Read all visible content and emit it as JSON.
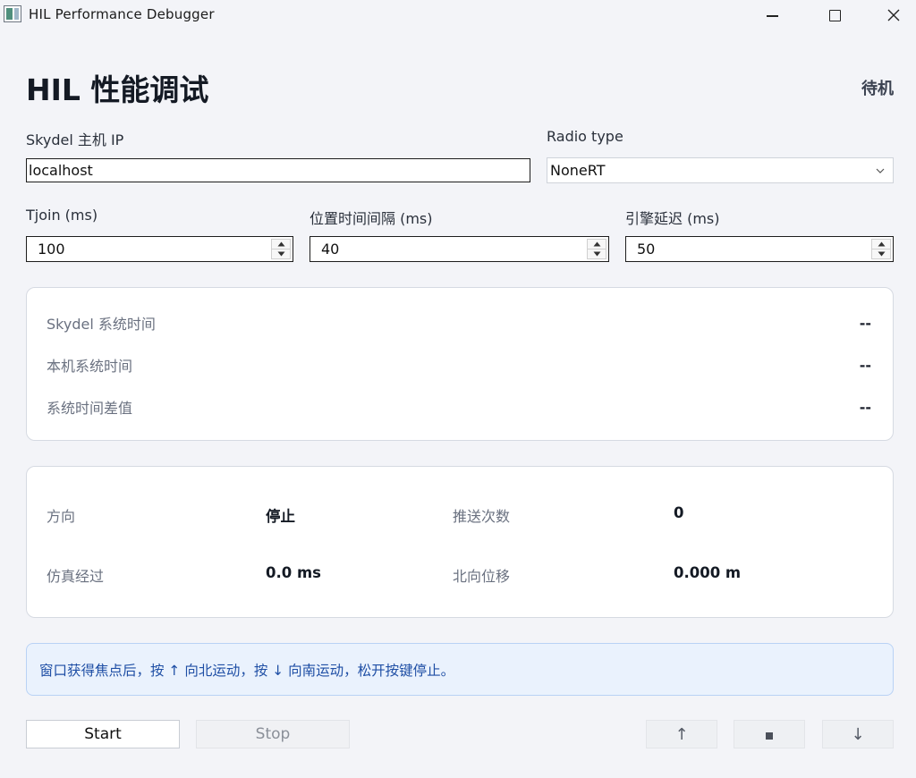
{
  "window": {
    "title": "HIL Performance Debugger",
    "icons": {
      "app": "app-icon",
      "minimize": "minimize-icon",
      "maximize": "maximize-icon",
      "close": "close-icon"
    }
  },
  "header": {
    "title": "HIL 性能调试",
    "status": "待机"
  },
  "connection": {
    "host_label": "Skydel 主机 IP",
    "host_value": "localhost",
    "radio_label": "Radio type",
    "radio_value": "NoneRT"
  },
  "params": {
    "tjoin_label": "Tjoin (ms)",
    "tjoin_value": "100",
    "interval_label": "位置时间间隔 (ms)",
    "interval_value": "40",
    "latency_label": "引擎延迟 (ms)",
    "latency_value": "50"
  },
  "time_panel": {
    "rows": [
      {
        "label": "Skydel 系统时间",
        "value": "--"
      },
      {
        "label": "本机系统时间",
        "value": "--"
      },
      {
        "label": "系统时间差值",
        "value": "--"
      }
    ]
  },
  "motion_panel": {
    "direction_label": "方向",
    "direction_value": "停止",
    "push_label": "推送次数",
    "push_value": "0",
    "elapsed_label": "仿真经过",
    "elapsed_value": "0.0 ms",
    "north_label": "北向位移",
    "north_value": "0.000 m"
  },
  "hint": {
    "text": "窗口获得焦点后，按 ↑ 向北运动，按 ↓ 向南运动，松开按键停止。"
  },
  "controls": {
    "start_label": "Start",
    "stop_label": "Stop",
    "up_label": "↑",
    "down_label": "↓"
  },
  "colors": {
    "background": "#f3f4f8",
    "hint_bg": "#eaf2fd",
    "hint_border": "#b9d2f5",
    "hint_text": "#1f4fa5",
    "muted_label": "#6a7180"
  }
}
